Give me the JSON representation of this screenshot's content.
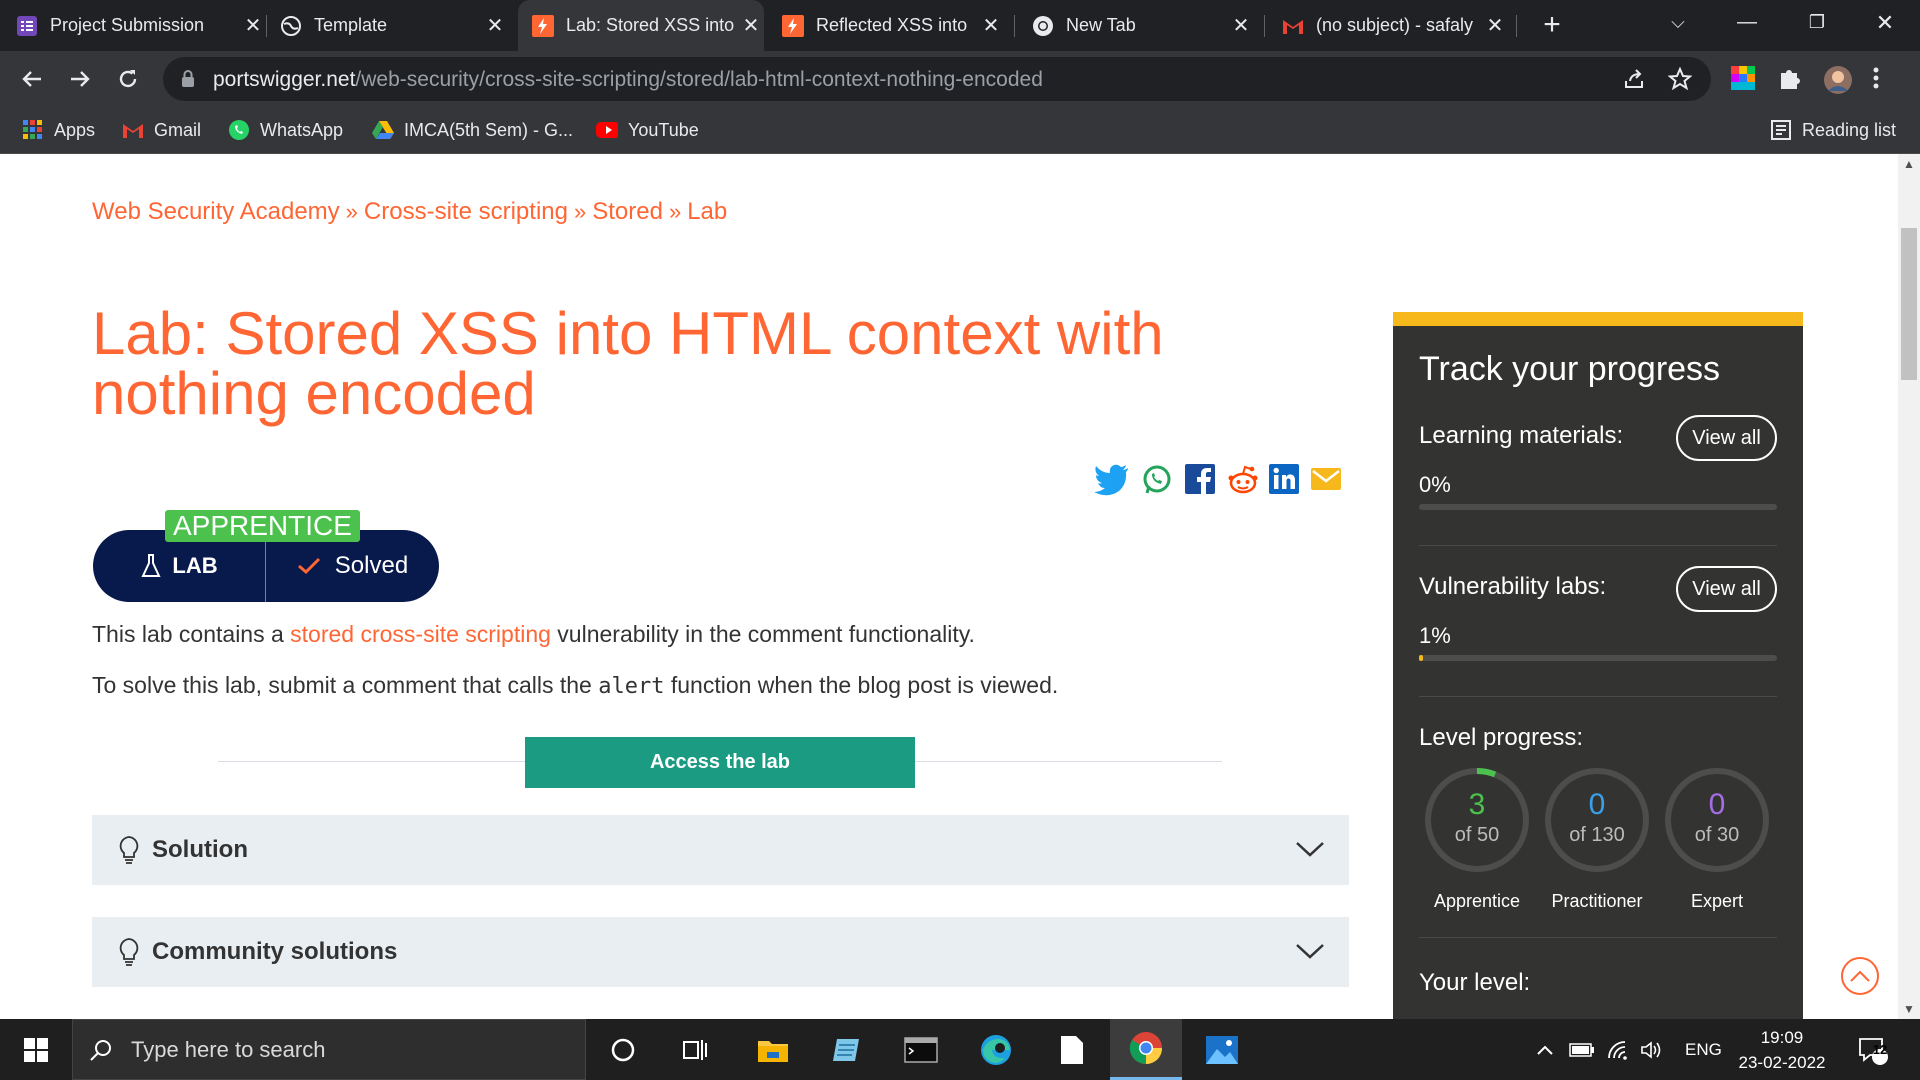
{
  "browser": {
    "tabs": [
      {
        "title": "Project Submission",
        "favicon": "forms-icon",
        "active": false
      },
      {
        "title": "Template",
        "favicon": "globe-icon",
        "active": false
      },
      {
        "title": "Lab: Stored XSS into",
        "favicon": "portswigger-icon",
        "active": true
      },
      {
        "title": "Reflected XSS into",
        "favicon": "portswigger-icon",
        "active": false
      },
      {
        "title": "New Tab",
        "favicon": "chrome-icon",
        "active": false
      },
      {
        "title": "(no subject) - safaly",
        "favicon": "gmail-icon",
        "active": false
      }
    ],
    "url_host": "portswigger.net",
    "url_path": "/web-security/cross-site-scripting/stored/lab-html-context-nothing-encoded",
    "bookmarks": [
      {
        "label": "Apps",
        "icon": "apps-grid-icon"
      },
      {
        "label": "Gmail",
        "icon": "gmail-icon"
      },
      {
        "label": "WhatsApp",
        "icon": "whatsapp-icon"
      },
      {
        "label": "IMCA(5th Sem) - G...",
        "icon": "google-drive-icon"
      },
      {
        "label": "YouTube",
        "icon": "youtube-icon"
      }
    ],
    "reading_list": "Reading list"
  },
  "page": {
    "breadcrumb": [
      "Web Security Academy",
      "Cross-site scripting",
      "Stored",
      "Lab"
    ],
    "breadcrumb_sep": "»",
    "title_line1": "Lab: Stored XSS into HTML context with",
    "title_line2": "nothing encoded",
    "level_tag": "APPRENTICE",
    "lab_label": "LAB",
    "status": "Solved",
    "desc_prefix": "This lab contains a ",
    "desc_link": "stored cross-site scripting",
    "desc_suffix": " vulnerability in the comment functionality.",
    "solve_prefix": "To solve this lab, submit a comment that calls the ",
    "solve_code": "alert",
    "solve_suffix": " function when the blog post is viewed.",
    "access_button": "Access the lab",
    "accordions": [
      "Solution",
      "Community solutions"
    ],
    "share_icons": [
      "twitter-icon",
      "whatsapp-icon",
      "facebook-icon",
      "reddit-icon",
      "linkedin-icon",
      "email-icon"
    ]
  },
  "sidebar": {
    "heading": "Track your progress",
    "learning_label": "Learning materials:",
    "learning_pct": "0%",
    "learning_value": 0,
    "vuln_label": "Vulnerability labs:",
    "vuln_pct": "1%",
    "vuln_value": 0.01,
    "view_all": "View all",
    "level_label": "Level progress:",
    "levels": [
      {
        "name": "Apprentice",
        "done": "3",
        "total": "of 50",
        "color": "#4cc14d",
        "fraction": 0.06
      },
      {
        "name": "Practitioner",
        "done": "0",
        "total": "of 130",
        "color": "#3b9fe8",
        "fraction": 0
      },
      {
        "name": "Expert",
        "done": "0",
        "total": "of 30",
        "color": "#a56de2",
        "fraction": 0
      }
    ],
    "your_level": "Your level:"
  },
  "taskbar": {
    "search_placeholder": "Type here to search",
    "time": "19:09",
    "date": "23-02-2022",
    "lang": "ENG",
    "notifications": "12"
  },
  "colors": {
    "accent": "#ff6633",
    "lab_button": "#1b9b82",
    "pill": "#08194c",
    "sidebar_bg": "#333332",
    "sidebar_top": "#f7b81b"
  }
}
